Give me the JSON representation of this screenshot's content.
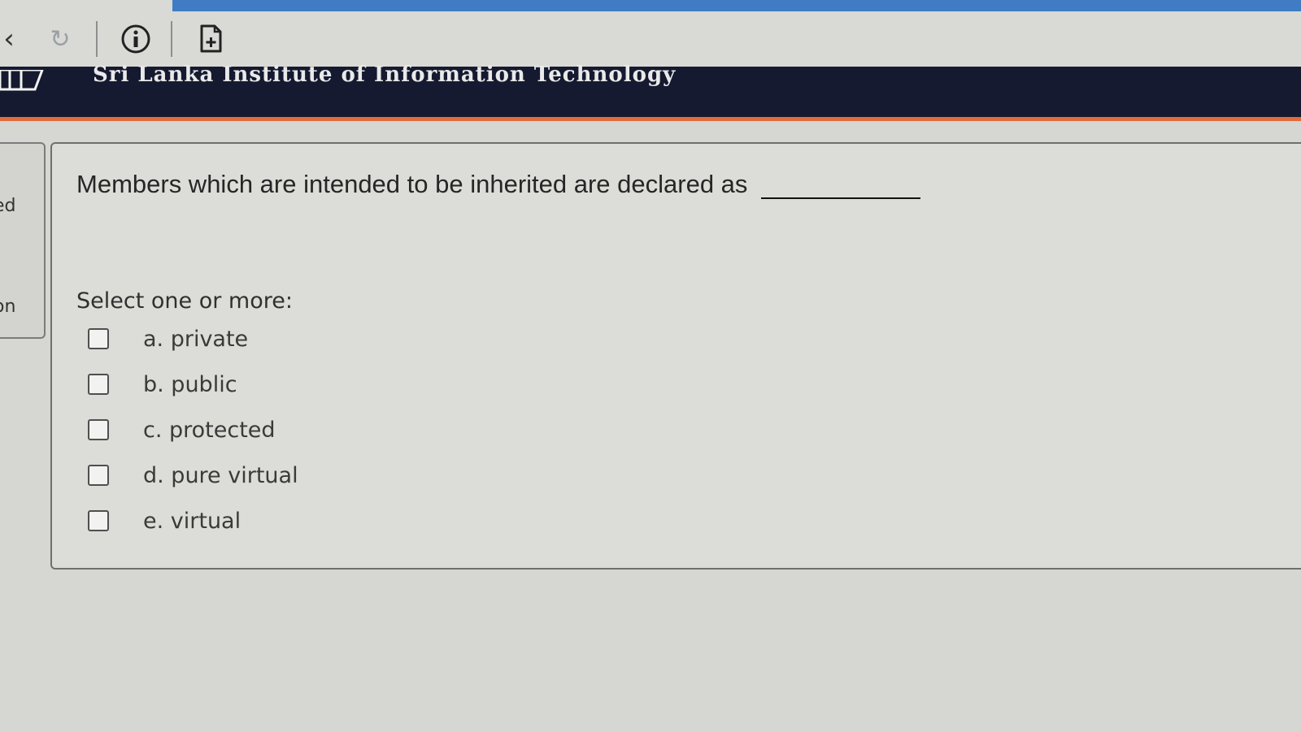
{
  "browser_toolbar": {
    "back_icon": "chevron-left-icon",
    "reload_icon": "reload-icon",
    "info_icon": "info-icon",
    "new_tab_icon": "new-tab-icon"
  },
  "site": {
    "title": "Sri Lanka Institute of Information Technology",
    "accent_color": "#e16b3c",
    "header_color": "#151a30"
  },
  "sidebar": {
    "partial_texts": [
      "ed",
      "on"
    ]
  },
  "question": {
    "text": "Members which are intended to be inherited are declared as",
    "prompt": "Select one or more:",
    "options": [
      {
        "label": "a. private",
        "checked": false
      },
      {
        "label": "b. public",
        "checked": false
      },
      {
        "label": "c. protected",
        "checked": false
      },
      {
        "label": "d. pure virtual",
        "checked": false
      },
      {
        "label": "e. virtual",
        "checked": false
      }
    ]
  }
}
